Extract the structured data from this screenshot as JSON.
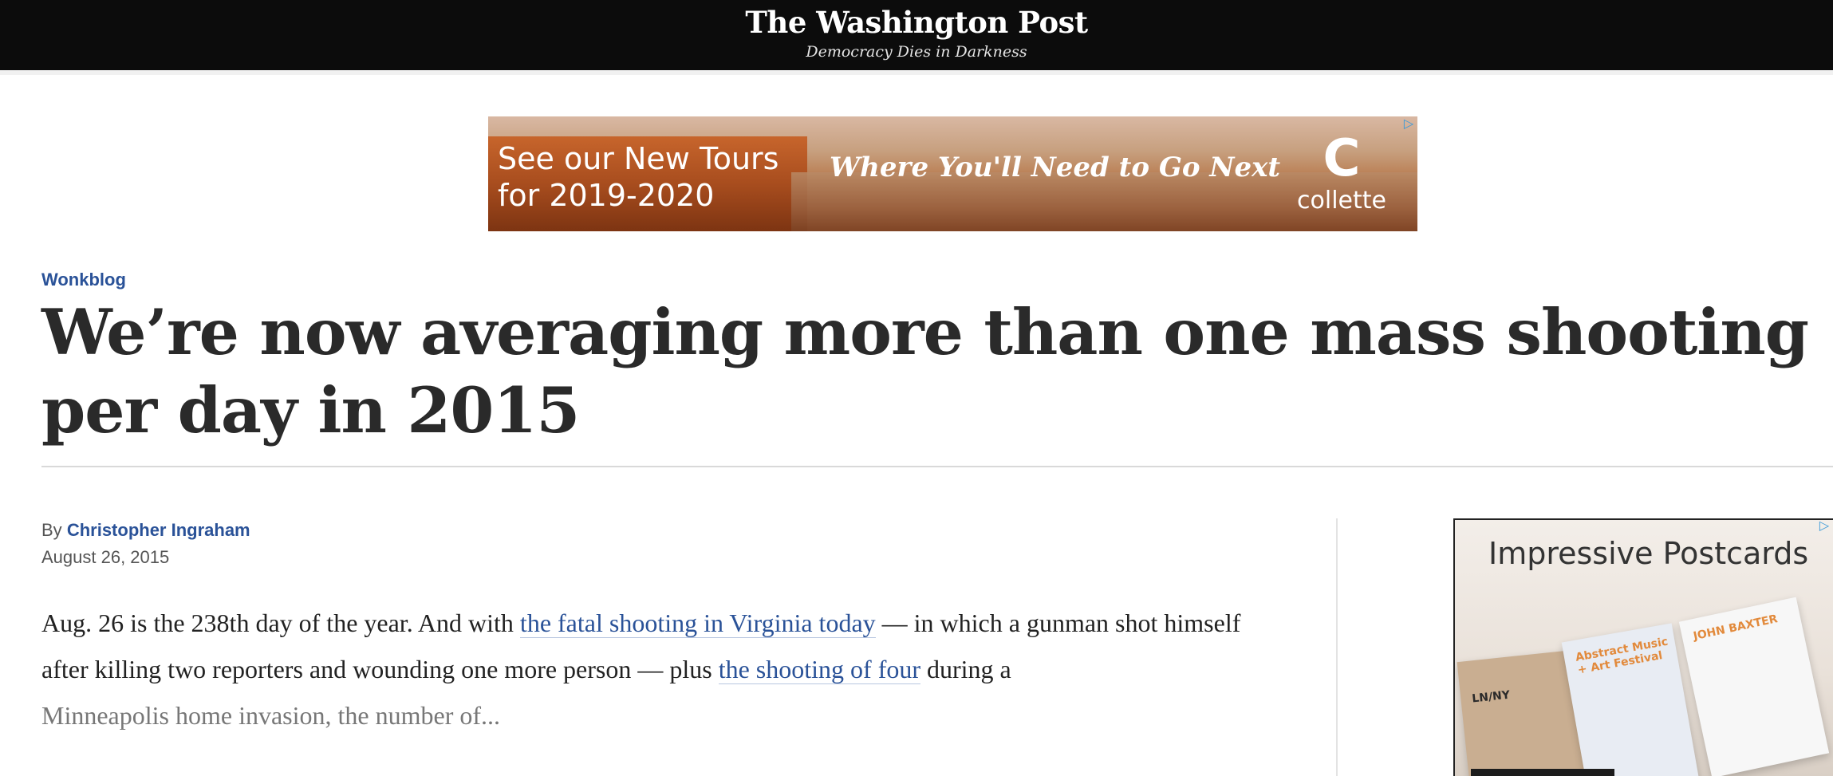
{
  "masthead": {
    "logo": "The Washington Post",
    "tagline": "Democracy Dies in Darkness"
  },
  "top_ad": {
    "headline": "See our New Tours for 2019-2020",
    "tagline": "Where You'll Need to Go Next",
    "brand_mark": "C",
    "brand": "collette",
    "adchoices_icon": "adchoices-icon"
  },
  "article": {
    "section": "Wonkblog",
    "title": "We’re now averaging more than one mass shooting per day in 2015",
    "byline_prefix": "By",
    "author": "Christopher Ingraham",
    "date": "August 26, 2015",
    "body": {
      "part1": "Aug. 26 is the 238th day of the year. And with ",
      "link1": "the fatal shooting in Virginia today",
      "part2": " — in which a gunman shot himself after killing two reporters and wounding one more person — plus ",
      "link2": "the shooting of four",
      "part3": " during a ",
      "fade": "Minneapolis home invasion, the number of..."
    }
  },
  "side_ad": {
    "title": "Impressive Postcards",
    "card_a": "LN/NY",
    "card_b": "Abstract Music + Art Festival",
    "card_c": "JOHN BAXTER"
  },
  "colors": {
    "topbar": "#0c0c0c",
    "link": "#2a5298"
  }
}
